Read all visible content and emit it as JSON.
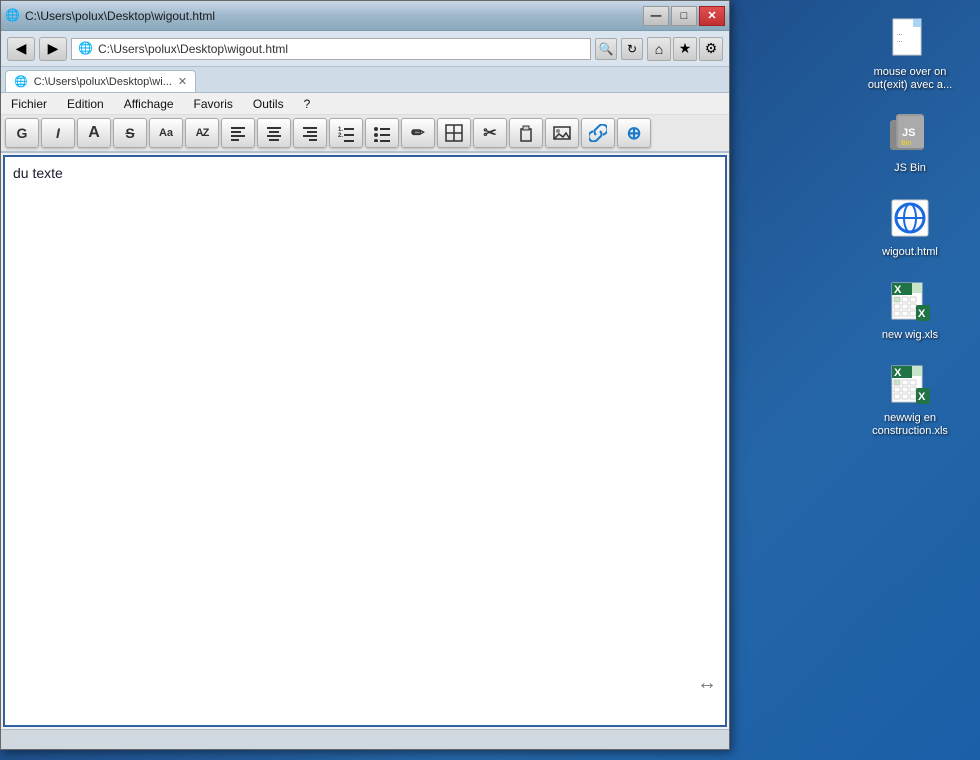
{
  "desktop": {
    "background_color": "#1a5fa8"
  },
  "browser": {
    "title": "C:\\Users\\polux\\Desktop\\wigout.html",
    "address": "C:\\Users\\polux\\Desktop\\wigout.html",
    "tab_label": "C:\\Users\\polux\\Desktop\\wi...",
    "window_controls": {
      "minimize": "—",
      "maximize": "□",
      "close": "✕"
    }
  },
  "nav_buttons": {
    "back": "◀",
    "forward": "▶"
  },
  "address_icons": {
    "refresh": "↻",
    "search": "🔍",
    "home": "⌂",
    "favorites": "★",
    "settings": "⚙"
  },
  "menu": {
    "items": [
      "Fichier",
      "Edition",
      "Affichage",
      "Favoris",
      "Outils",
      "?"
    ]
  },
  "editor_toolbar": {
    "buttons": [
      {
        "id": "bold",
        "label": "G",
        "title": "Gras"
      },
      {
        "id": "italic",
        "label": "I",
        "title": "Italique"
      },
      {
        "id": "font-size",
        "label": "A",
        "title": "Taille police"
      },
      {
        "id": "strikethrough",
        "label": "S",
        "title": "Barré"
      },
      {
        "id": "font-format",
        "label": "Aa",
        "title": "Format"
      },
      {
        "id": "font-color",
        "label": "AZ",
        "title": "Couleur"
      },
      {
        "id": "align-left",
        "label": "≡",
        "title": "Aligner gauche"
      },
      {
        "id": "align-center",
        "label": "≡",
        "title": "Centrer"
      },
      {
        "id": "align-right",
        "label": "≡",
        "title": "Aligner droite"
      },
      {
        "id": "list-ol",
        "label": "≔",
        "title": "Liste numérotée"
      },
      {
        "id": "list-ul",
        "label": "≔",
        "title": "Liste à puces"
      },
      {
        "id": "highlight",
        "label": "✏",
        "title": "Surligneur"
      },
      {
        "id": "table",
        "label": "▦",
        "title": "Tableau"
      },
      {
        "id": "cut",
        "label": "✂",
        "title": "Couper"
      },
      {
        "id": "paste",
        "label": "📋",
        "title": "Coller"
      },
      {
        "id": "image",
        "label": "🖼",
        "title": "Image"
      },
      {
        "id": "link",
        "label": "🔗",
        "title": "Lien"
      },
      {
        "id": "misc",
        "label": "⊕",
        "title": "Divers"
      }
    ]
  },
  "content": {
    "text": "du texte"
  },
  "desktop_icons": [
    {
      "id": "mouse-over",
      "label": "mouse over on\nout(exit) avec a...",
      "icon_type": "text_file",
      "icon_char": "📄"
    },
    {
      "id": "jsbin",
      "label": "JS Bin",
      "icon_type": "jsbin",
      "icon_char": "JS"
    },
    {
      "id": "wigout",
      "label": "wigout.html",
      "icon_type": "ie",
      "icon_char": "e"
    },
    {
      "id": "new-wig",
      "label": "new wig.xls",
      "icon_type": "excel",
      "icon_char": "X"
    },
    {
      "id": "newwig-construction",
      "label": "newwig en\nconstruction.xls",
      "icon_type": "excel",
      "icon_char": "X"
    }
  ]
}
